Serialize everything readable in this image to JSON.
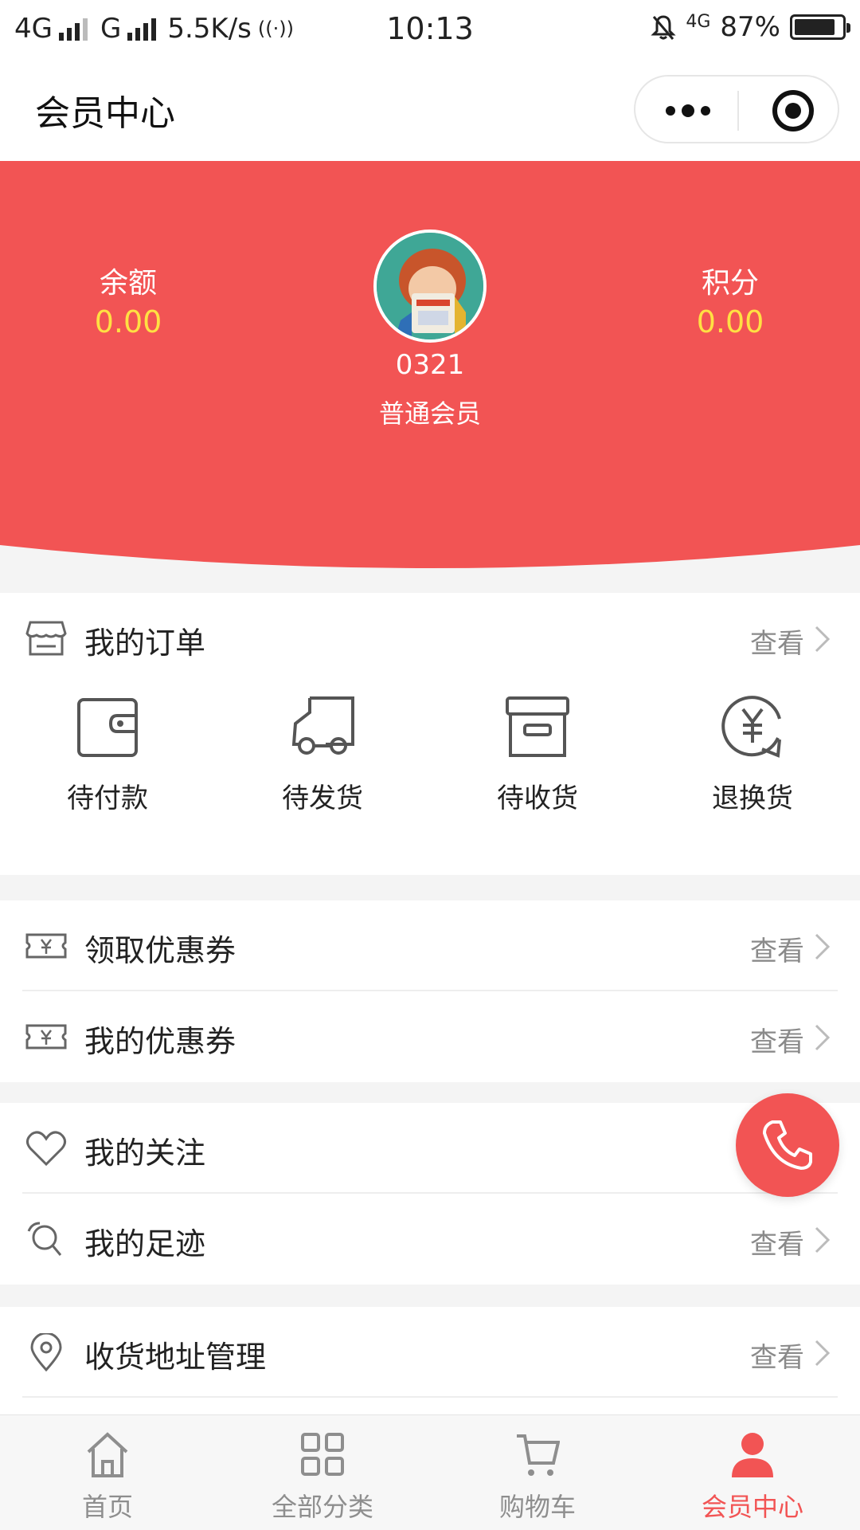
{
  "status_bar": {
    "network1": "4G",
    "network2": "G",
    "speed": "5.5K/s",
    "time": "10:13",
    "network3": "4G",
    "battery": "87%",
    "battery_level": 0.87
  },
  "nav": {
    "title": "会员中心"
  },
  "profile": {
    "balance_label": "余额",
    "balance_value": "0.00",
    "points_label": "积分",
    "points_value": "0.00",
    "username": "0321",
    "level": "普通会员"
  },
  "orders": {
    "title": "我的订单",
    "more": "查看",
    "items": [
      {
        "label": "待付款",
        "icon": "wallet-icon"
      },
      {
        "label": "待发货",
        "icon": "truck-icon"
      },
      {
        "label": "待收货",
        "icon": "box-icon"
      },
      {
        "label": "退换货",
        "icon": "yuan-exchange-icon"
      }
    ]
  },
  "menu": {
    "get_coupons": {
      "label": "领取优惠券",
      "more": "查看",
      "icon": "coupon-icon"
    },
    "my_coupons": {
      "label": "我的优惠券",
      "more": "查看",
      "icon": "coupon-icon"
    },
    "favorites": {
      "label": "我的关注",
      "icon": "heart-icon"
    },
    "footprints": {
      "label": "我的足迹",
      "more": "查看",
      "icon": "footprint-icon"
    },
    "address": {
      "label": "收货地址管理",
      "more": "查看",
      "icon": "location-icon"
    }
  },
  "tabbar": {
    "items": [
      {
        "label": "首页",
        "icon": "home-icon"
      },
      {
        "label": "全部分类",
        "icon": "grid-icon"
      },
      {
        "label": "购物车",
        "icon": "cart-icon"
      },
      {
        "label": "会员中心",
        "icon": "user-icon"
      }
    ],
    "active_index": 3
  },
  "colors": {
    "brand_red": "#f25454",
    "value_yellow": "#ffe043",
    "muted_gray": "#8a8a8a"
  }
}
